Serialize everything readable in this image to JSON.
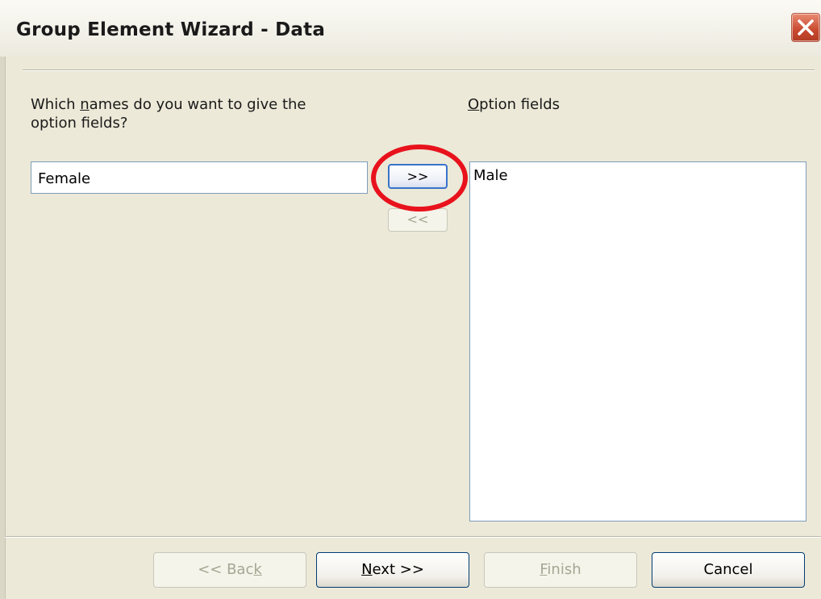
{
  "window": {
    "title": "Group Element Wizard - Data"
  },
  "prompt": {
    "line1_pre": "Which ",
    "line1_accel": "n",
    "line1_post": "ames do you want to give the",
    "line2": "option fields?"
  },
  "name_input": {
    "value": "Female"
  },
  "transfer": {
    "add_label": ">>",
    "remove_label": "<<"
  },
  "options": {
    "label_accel": "O",
    "label_rest": "ption fields",
    "items": [
      "Male"
    ]
  },
  "footer": {
    "back_pre": "<< Bac",
    "back_accel": "k",
    "next_accel": "N",
    "next_post": "ext >>",
    "finish_accel": "F",
    "finish_post": "inish",
    "cancel_label": "Cancel"
  },
  "colors": {
    "highlight_ring": "#e8121c",
    "window_bg": "#ece9d8",
    "close_button": "#c8492e"
  }
}
